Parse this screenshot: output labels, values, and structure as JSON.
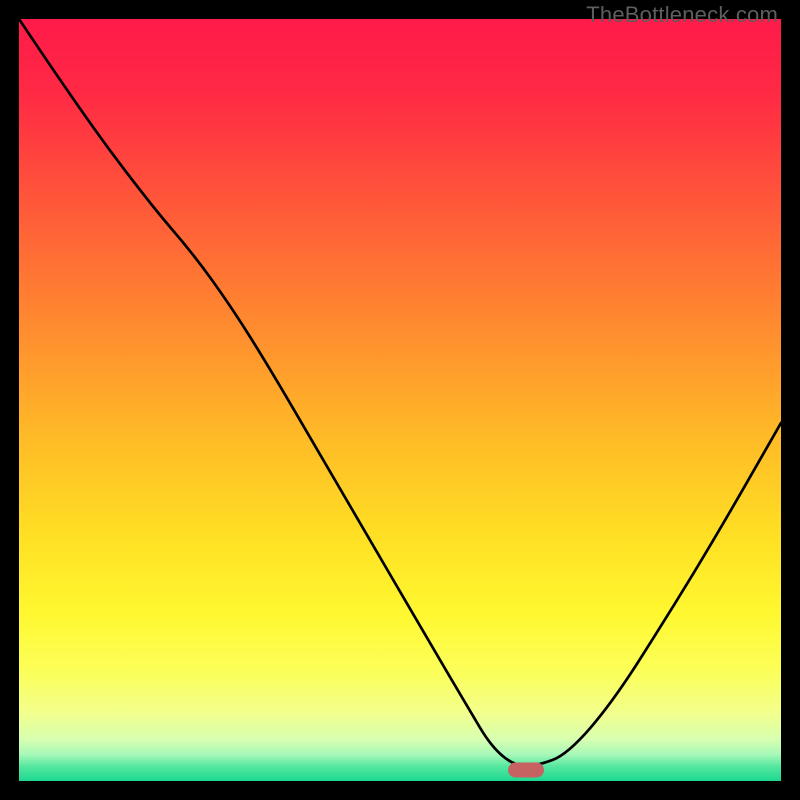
{
  "watermark": "TheBottleneck.com",
  "gradient_stops": [
    {
      "offset": 0.0,
      "color": "#ff1a4a"
    },
    {
      "offset": 0.1,
      "color": "#ff2a44"
    },
    {
      "offset": 0.25,
      "color": "#ff5a39"
    },
    {
      "offset": 0.4,
      "color": "#ff8a2f"
    },
    {
      "offset": 0.55,
      "color": "#ffbb27"
    },
    {
      "offset": 0.68,
      "color": "#ffe024"
    },
    {
      "offset": 0.78,
      "color": "#fff830"
    },
    {
      "offset": 0.86,
      "color": "#fbff5c"
    },
    {
      "offset": 0.91,
      "color": "#f2ff8c"
    },
    {
      "offset": 0.945,
      "color": "#d8ffb0"
    },
    {
      "offset": 0.965,
      "color": "#a8f8b8"
    },
    {
      "offset": 0.98,
      "color": "#58e8a0"
    },
    {
      "offset": 1.0,
      "color": "#1cd890"
    }
  ],
  "marker": {
    "x_frac": 0.665,
    "y_frac": 0.985,
    "color": "#c76263"
  },
  "chart_data": {
    "type": "line",
    "title": "",
    "xlabel": "",
    "ylabel": "",
    "xlim": [
      0,
      1
    ],
    "ylim": [
      0,
      1
    ],
    "series": [
      {
        "name": "curve",
        "x": [
          0.0,
          0.08,
          0.17,
          0.23,
          0.28,
          0.33,
          0.4,
          0.47,
          0.54,
          0.59,
          0.62,
          0.65,
          0.68,
          0.72,
          0.78,
          0.85,
          0.92,
          1.0
        ],
        "y": [
          1.0,
          0.88,
          0.76,
          0.69,
          0.62,
          0.54,
          0.42,
          0.3,
          0.18,
          0.095,
          0.045,
          0.02,
          0.02,
          0.035,
          0.105,
          0.215,
          0.33,
          0.47
        ]
      }
    ],
    "marker_point": {
      "x": 0.665,
      "y": 0.015
    },
    "annotations": [
      {
        "text": "TheBottleneck.com",
        "position": "top-right"
      }
    ]
  }
}
